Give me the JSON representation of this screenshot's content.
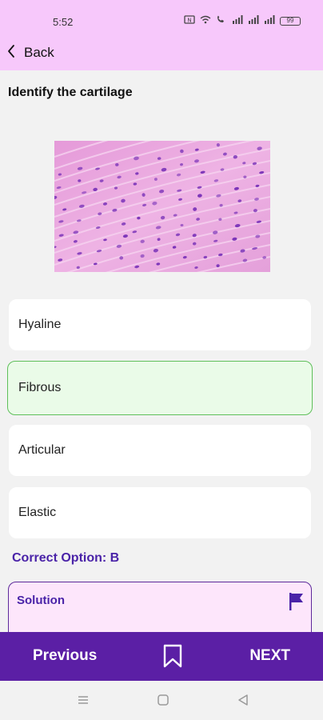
{
  "status_bar": {
    "time": "5:52",
    "icons": [
      "nfc-icon",
      "wifi-icon",
      "wifi-call-icon",
      "signal-icon",
      "signal-icon",
      "signal-icon"
    ],
    "battery": "99"
  },
  "header": {
    "back_label": "Back",
    "background": "#f7c8fb"
  },
  "question": {
    "text": "Identify the cartilage",
    "image_alt": "histology-micrograph"
  },
  "options": [
    {
      "label": "Hyaline",
      "selected": false
    },
    {
      "label": "Fibrous",
      "selected": true
    },
    {
      "label": "Articular",
      "selected": false
    },
    {
      "label": "Elastic",
      "selected": false
    }
  ],
  "answer": {
    "correct_text": "Correct Option: B"
  },
  "solution": {
    "title": "Solution"
  },
  "bottom_bar": {
    "previous_label": "Previous",
    "next_label": "NEXT",
    "background": "#5b1fa5"
  },
  "colors": {
    "accent": "#4a23a8",
    "selected_bg": "#eafbe8",
    "selected_border": "#5fbf5a"
  }
}
